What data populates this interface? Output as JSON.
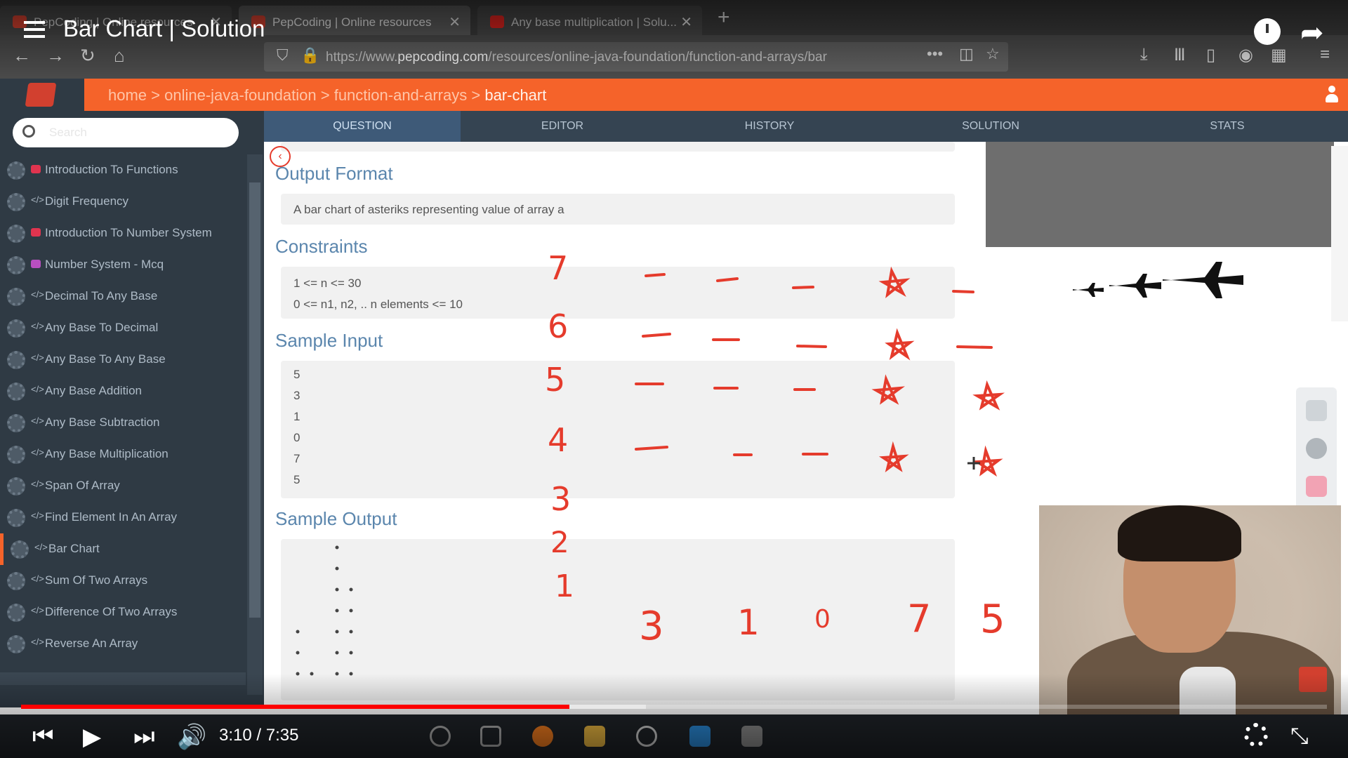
{
  "video": {
    "title": "Bar Chart | Solution",
    "time": "3:10 / 7:35",
    "progress_fraction": 0.42
  },
  "browser": {
    "tabs": [
      {
        "label": "PepCoding | Online resources"
      },
      {
        "label": "PepCoding | Online resources"
      },
      {
        "label": "Any base multiplication | Solu..."
      }
    ],
    "url_prefix": "https://www.",
    "url_domain": "pepcoding.com",
    "url_path": "/resources/online-java-foundation/function-and-arrays/bar"
  },
  "breadcrumb": {
    "home": "home",
    "sep": " > ",
    "c1": "online-java-foundation",
    "c2": "function-and-arrays",
    "current": "bar-chart"
  },
  "sidebar": {
    "search_placeholder": "Search",
    "items": [
      {
        "label": "Introduction To Functions"
      },
      {
        "label": "Digit Frequency"
      },
      {
        "label": "Introduction To Number System"
      },
      {
        "label": "Number System - Mcq"
      },
      {
        "label": "Decimal To Any Base"
      },
      {
        "label": "Any Base To Decimal"
      },
      {
        "label": "Any Base To Any Base"
      },
      {
        "label": "Any Base Addition"
      },
      {
        "label": "Any Base Subtraction"
      },
      {
        "label": "Any Base Multiplication"
      },
      {
        "label": "Span Of Array"
      },
      {
        "label": "Find Element In An Array"
      },
      {
        "label": "Bar Chart"
      },
      {
        "label": "Sum Of Two Arrays"
      },
      {
        "label": "Difference Of Two Arrays"
      },
      {
        "label": "Reverse An Array"
      }
    ]
  },
  "tabs": {
    "question": "QUESTION",
    "editor": "EDITOR",
    "history": "HISTORY",
    "solution": "SOLUTION",
    "stats": "STATS"
  },
  "content": {
    "output_format_title": "Output Format",
    "output_format_text": "A bar chart of asteriks representing value of array a",
    "constraints_title": "Constraints",
    "constraint_1": "1 <= n <= 30",
    "constraint_2": "0 <= n1, n2, .. n elements <= 10",
    "sample_input_title": "Sample Input",
    "sample_input": [
      "5",
      "3",
      "1",
      "0",
      "7",
      "5"
    ],
    "sample_output_title": "Sample Output"
  },
  "ink": {
    "levels": [
      "7",
      "6",
      "5",
      "4",
      "3",
      "2",
      "1"
    ],
    "bottom": [
      "3",
      "1",
      "0",
      "7",
      "5"
    ]
  }
}
